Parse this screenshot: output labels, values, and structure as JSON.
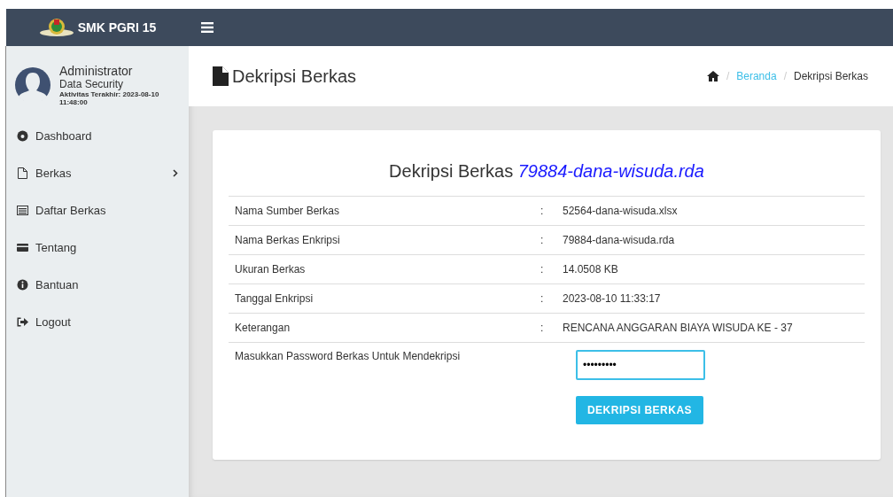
{
  "brand": {
    "title": "SMK PGRI 15"
  },
  "user": {
    "name": "Administrator",
    "role": "Data Security",
    "last_activity": "Aktivitas Terakhir: 2023-08-10 11:48:00"
  },
  "sidebar": {
    "items": [
      {
        "label": "Dashboard",
        "has_submenu": false
      },
      {
        "label": "Berkas",
        "has_submenu": true
      },
      {
        "label": "Daftar Berkas",
        "has_submenu": false
      },
      {
        "label": "Tentang",
        "has_submenu": false
      },
      {
        "label": "Bantuan",
        "has_submenu": false
      },
      {
        "label": "Logout",
        "has_submenu": false
      }
    ]
  },
  "page": {
    "title": "Dekripsi Berkas",
    "breadcrumb": [
      {
        "separator": "/",
        "label": "Beranda",
        "link": true
      },
      {
        "separator": "/",
        "label": "Dekripsi Berkas",
        "link": false
      }
    ]
  },
  "card": {
    "heading": "Dekripsi Berkas",
    "file_name": "79884-dana-wisuda.rda",
    "rows": [
      {
        "label": "Nama Sumber Berkas",
        "separator": ":",
        "value": "52564-dana-wisuda.xlsx"
      },
      {
        "label": "Nama Berkas Enkripsi",
        "separator": ":",
        "value": "79884-dana-wisuda.rda"
      },
      {
        "label": "Ukuran Berkas",
        "separator": ":",
        "value": "14.0508 KB"
      },
      {
        "label": "Tanggal Enkripsi",
        "separator": ":",
        "value": "2023-08-10 11:33:17"
      },
      {
        "label": "Keterangan",
        "separator": ":",
        "value": "RENCANA ANGGARAN BIAYA WISUDA KE - 37"
      }
    ],
    "password": {
      "label": "Masukkan Password Berkas Untuk Mendekripsi",
      "value": "•••••••••",
      "focused": true
    },
    "button": "DEKRIPSI BERKAS"
  }
}
